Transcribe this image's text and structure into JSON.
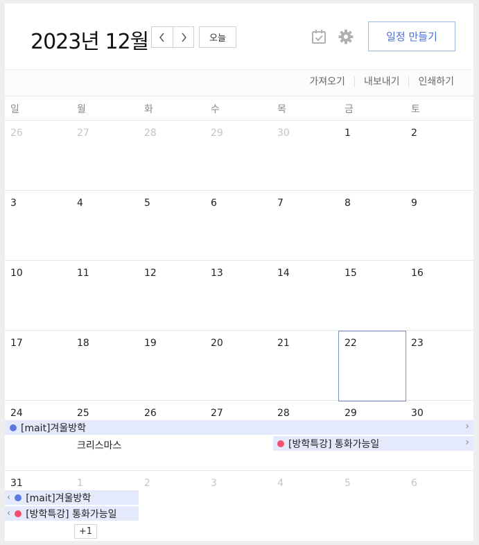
{
  "header": {
    "month_title": "2023년 12월",
    "prev_icon": "chevron-left-icon",
    "next_icon": "chevron-right-icon",
    "today_label": "오늘",
    "task_icon": "task-check-icon",
    "settings_icon": "gear-icon",
    "create_label": "일정 만들기"
  },
  "toolbar": {
    "import_label": "가져오기",
    "export_label": "내보내기",
    "print_label": "인쇄하기"
  },
  "weekdays": [
    "일",
    "월",
    "화",
    "수",
    "목",
    "금",
    "토"
  ],
  "weeks": [
    [
      "26",
      "27",
      "28",
      "29",
      "30",
      "1",
      "2"
    ],
    [
      "3",
      "4",
      "5",
      "6",
      "7",
      "8",
      "9"
    ],
    [
      "10",
      "11",
      "12",
      "13",
      "14",
      "15",
      "16"
    ],
    [
      "17",
      "18",
      "19",
      "20",
      "21",
      "22",
      "23"
    ],
    [
      "24",
      "25",
      "26",
      "27",
      "28",
      "29",
      "30"
    ],
    [
      "31",
      "1",
      "2",
      "3",
      "4",
      "5",
      "6"
    ]
  ],
  "events": {
    "winter_break": "[mait]겨울방학",
    "christmas": "크리스마스",
    "call_available": "[방학특강] 통화가능일",
    "more_label": "+1"
  },
  "colors": {
    "accent": "#4a6fd3",
    "event_blue": "#5b7be0",
    "event_red": "#f2506e",
    "event_bg": "#e4e9fb"
  }
}
